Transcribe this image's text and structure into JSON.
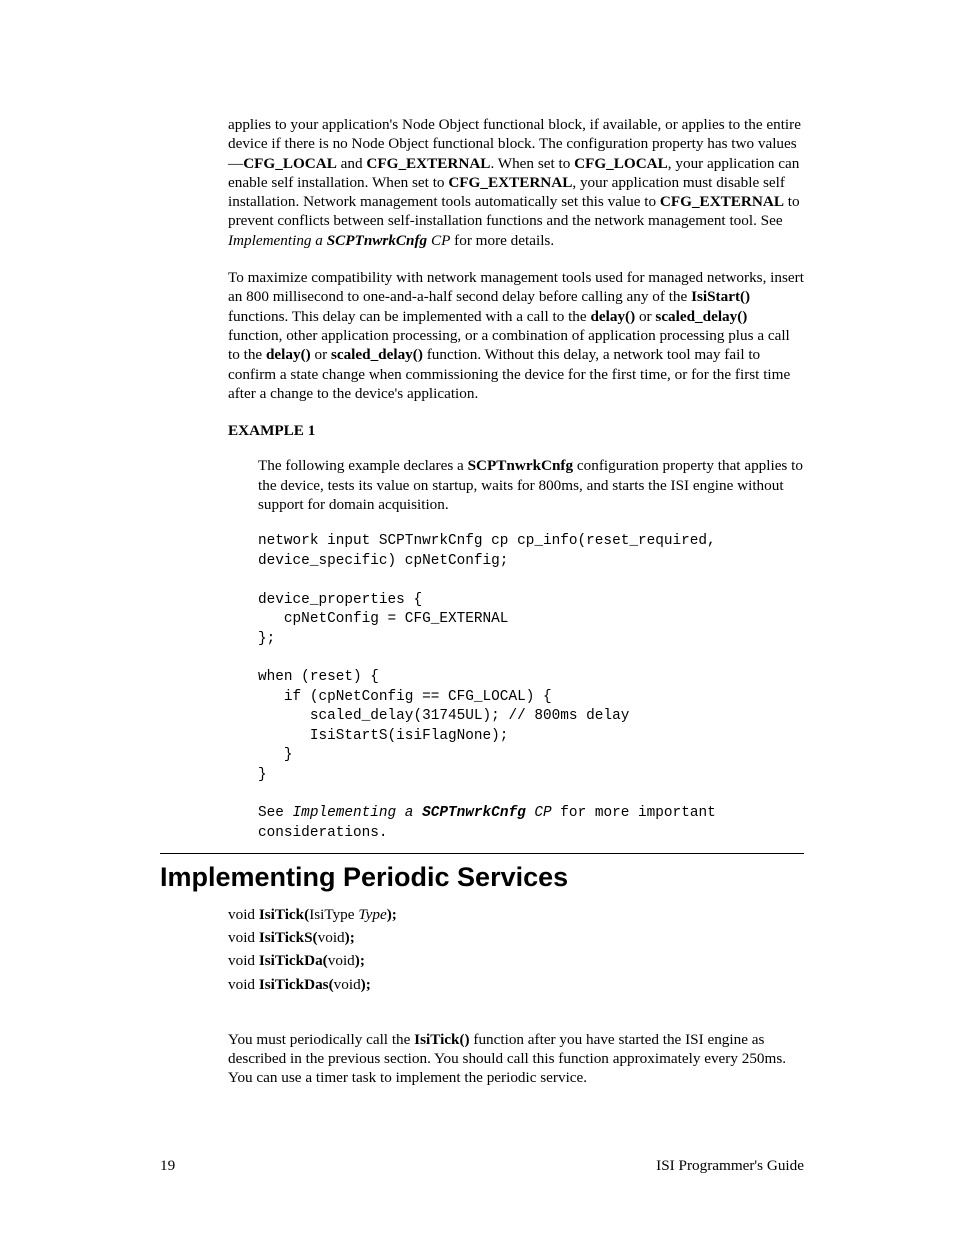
{
  "p1": {
    "t1": "applies to your application's Node Object functional block, if available, or applies to the entire device if there is no Node Object functional block.  The configuration property has two values—",
    "b1": "CFG_LOCAL",
    "t2": " and ",
    "b2": "CFG_EXTERNAL",
    "t3": ".  When set to ",
    "b3": "CFG_LOCAL",
    "t4": ", your application can enable self installation.  When set to ",
    "b4": "CFG_EXTERNAL",
    "t5": ", your application must disable self installation.  Network management tools automatically set this value to ",
    "b5": "CFG_EXTERNAL",
    "t6": " to prevent conflicts between self-installation functions and the network management tool.  See ",
    "i1": "Implementing a ",
    "bi1": "SCPTnwrkCnfg",
    "i2": " CP",
    "t7": " for more details."
  },
  "p2": {
    "t1": "To maximize compatibility with network management tools used for managed networks, insert an 800 millisecond to one-and-a-half second delay before calling any of the ",
    "b1": "IsiStart()",
    "t2": " functions.  This delay can be implemented with a call to the ",
    "b2": "delay()",
    "t3": " or ",
    "b3": "scaled_delay()",
    "t4": " function, other application processing, or a combination of application processing plus a call to the ",
    "b4": "delay()",
    "t5": " or ",
    "b5": "scaled_delay()",
    "t6": " function.  Without this delay, a network tool may fail to confirm a state change when commissioning the device for the first time, or for the first time after a change to the device's application."
  },
  "example_heading": "EXAMPLE 1",
  "p3": {
    "t1": "The following example declares a ",
    "b1": "SCPTnwrkCnfg",
    "t2": " configuration property that applies to the device, tests its value on startup, waits for 800ms, and starts the ISI engine without support for domain acquisition."
  },
  "code": {
    "l1": "network input SCPTnwrkCnfg cp cp_info(reset_required,",
    "l2": "device_specific) cpNetConfig;",
    "l3": "",
    "l4": "device_properties {",
    "l5": "   cpNetConfig = CFG_EXTERNAL",
    "l6": "};",
    "l7": "",
    "l8": "when (reset) {",
    "l9": "   if (cpNetConfig == CFG_LOCAL) {",
    "l10": "      scaled_delay(31745UL); // 800ms delay",
    "l11": "      IsiStartS(isiFlagNone);",
    "l12": "   }",
    "l13": "}",
    "l14": "",
    "see_pre": "See ",
    "see_i1": "Implementing a ",
    "see_bi": "SCPTnwrkCnfg",
    "see_i2": " CP",
    "see_post": " for more important",
    "l16": "considerations."
  },
  "section_heading": "Implementing Periodic Services",
  "sig1": {
    "t1": "void ",
    "b1": "IsiTick(",
    "t2": "IsiType ",
    "i1": "Type",
    "b2": ");"
  },
  "sig2": {
    "t1": "void ",
    "b1": "IsiTickS(",
    "t2": "void",
    "b2": ");"
  },
  "sig3": {
    "t1": "void ",
    "b1": "IsiTickDa(",
    "t2": "void",
    "b2": ");"
  },
  "sig4": {
    "t1": "void ",
    "b1": "IsiTickDas(",
    "t2": "void",
    "b2": ");"
  },
  "p4": {
    "t1": "You must periodically call the ",
    "b1": "IsiTick()",
    "t2": " function after you have started the ISI engine as described in the previous section.  You should call this function approximately every 250ms.  You can use a timer task to implement the periodic service."
  },
  "footer": {
    "page": "19",
    "title": "ISI Programmer's Guide"
  }
}
